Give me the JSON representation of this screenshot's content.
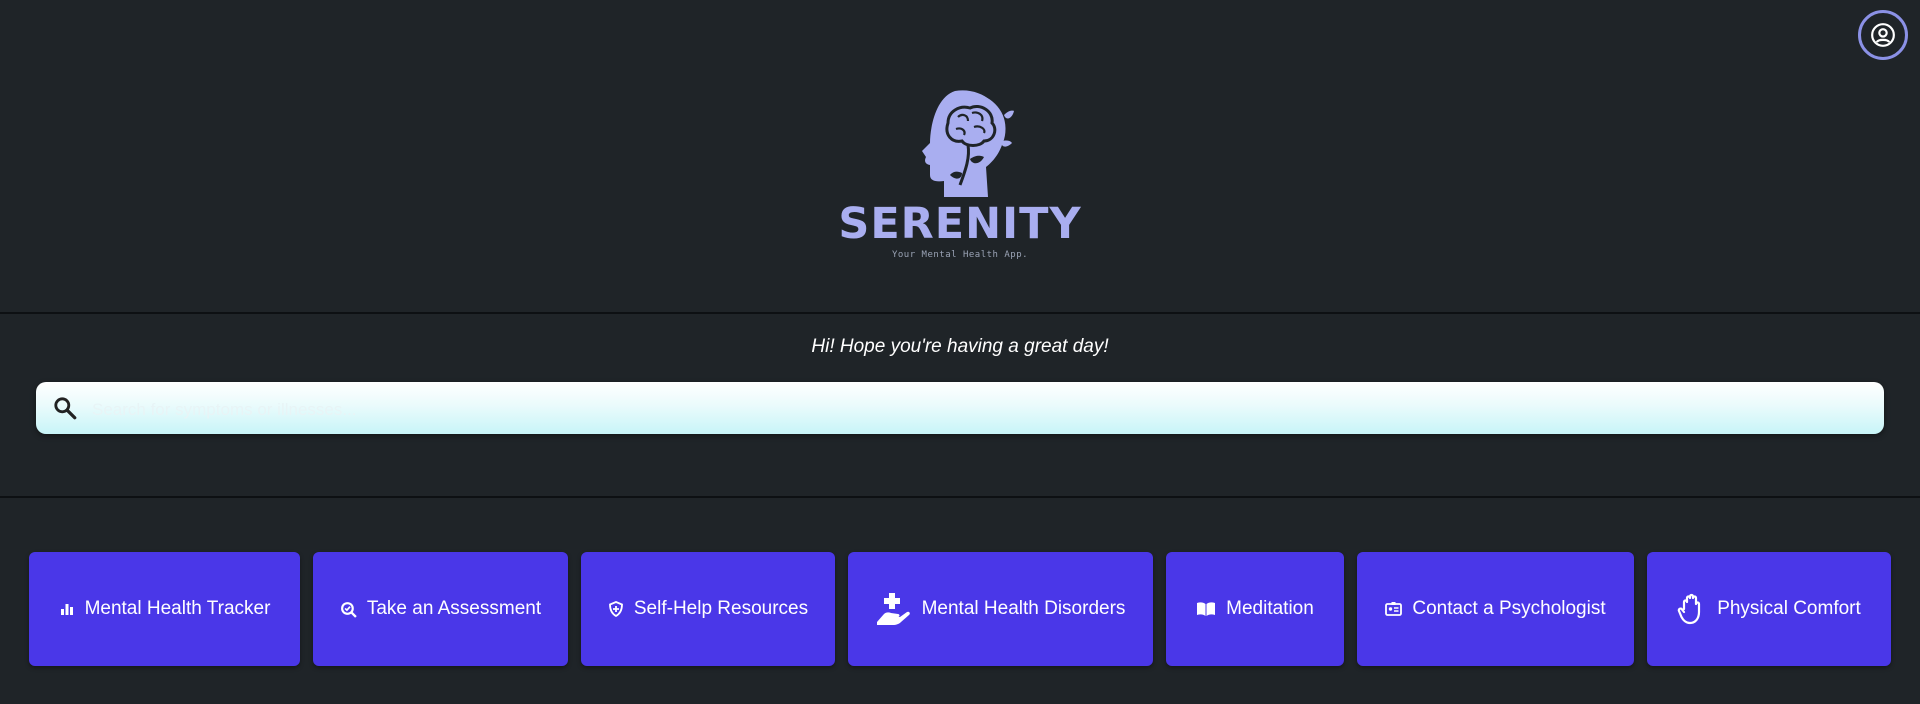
{
  "app": {
    "brand": "SERENITY",
    "tagline": "Your Mental Health App.",
    "greeting": "Hi! Hope you're having a great day!"
  },
  "search": {
    "placeholder": "Search for symptoms or illnesses..."
  },
  "icons": {
    "profile": "user-circle-icon",
    "search": "magnifier-icon",
    "logo": "brain-head-icon"
  },
  "colors": {
    "background": "#1f2428",
    "accent": "#4a37e8",
    "brand": "#a9aef0"
  },
  "features": [
    {
      "label": "Mental Health Tracker",
      "icon": "bar-chart-icon"
    },
    {
      "label": "Take an Assessment",
      "icon": "magnify-check-icon"
    },
    {
      "label": "Self-Help Resources",
      "icon": "shield-icon"
    },
    {
      "label": "Mental Health Disorders",
      "icon": "hand-medical-icon"
    },
    {
      "label": "Meditation",
      "icon": "book-open-icon"
    },
    {
      "label": "Contact a Psychologist",
      "icon": "id-card-icon"
    },
    {
      "label": "Physical Comfort",
      "icon": "hand-icon"
    }
  ]
}
